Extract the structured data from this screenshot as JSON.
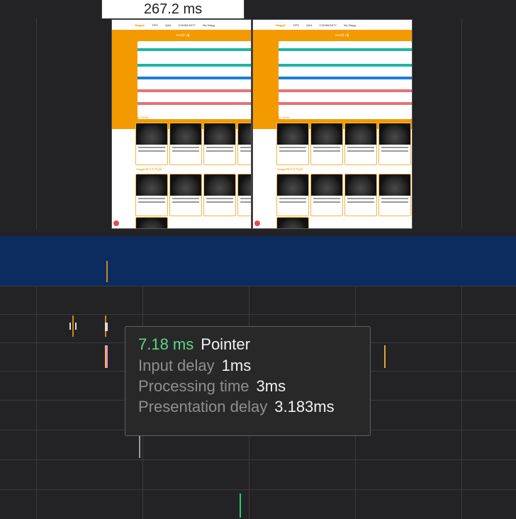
{
  "header": {
    "time_label": "267.2 ms"
  },
  "film": {
    "brand": "Waggle",
    "nav_items": [
      "TIPS",
      "Q&A",
      "COMMUNITY",
      "My Wagg"
    ],
    "calendar_title": "2024년 1월",
    "section_my_team": "My TEAM",
    "section_recommend": "Waggle에서 인기팀들"
  },
  "tooltip": {
    "duration": "7.18 ms",
    "type": "Pointer",
    "rows": [
      {
        "label": "Input delay",
        "value": "1ms"
      },
      {
        "label": "Processing time",
        "value": "3ms"
      },
      {
        "label": "Presentation delay",
        "value": "3.183ms"
      }
    ]
  },
  "colors": {
    "accent_green": "#5ed686",
    "track_blue": "#0c2b5e",
    "film_orange": "#f39a00"
  }
}
